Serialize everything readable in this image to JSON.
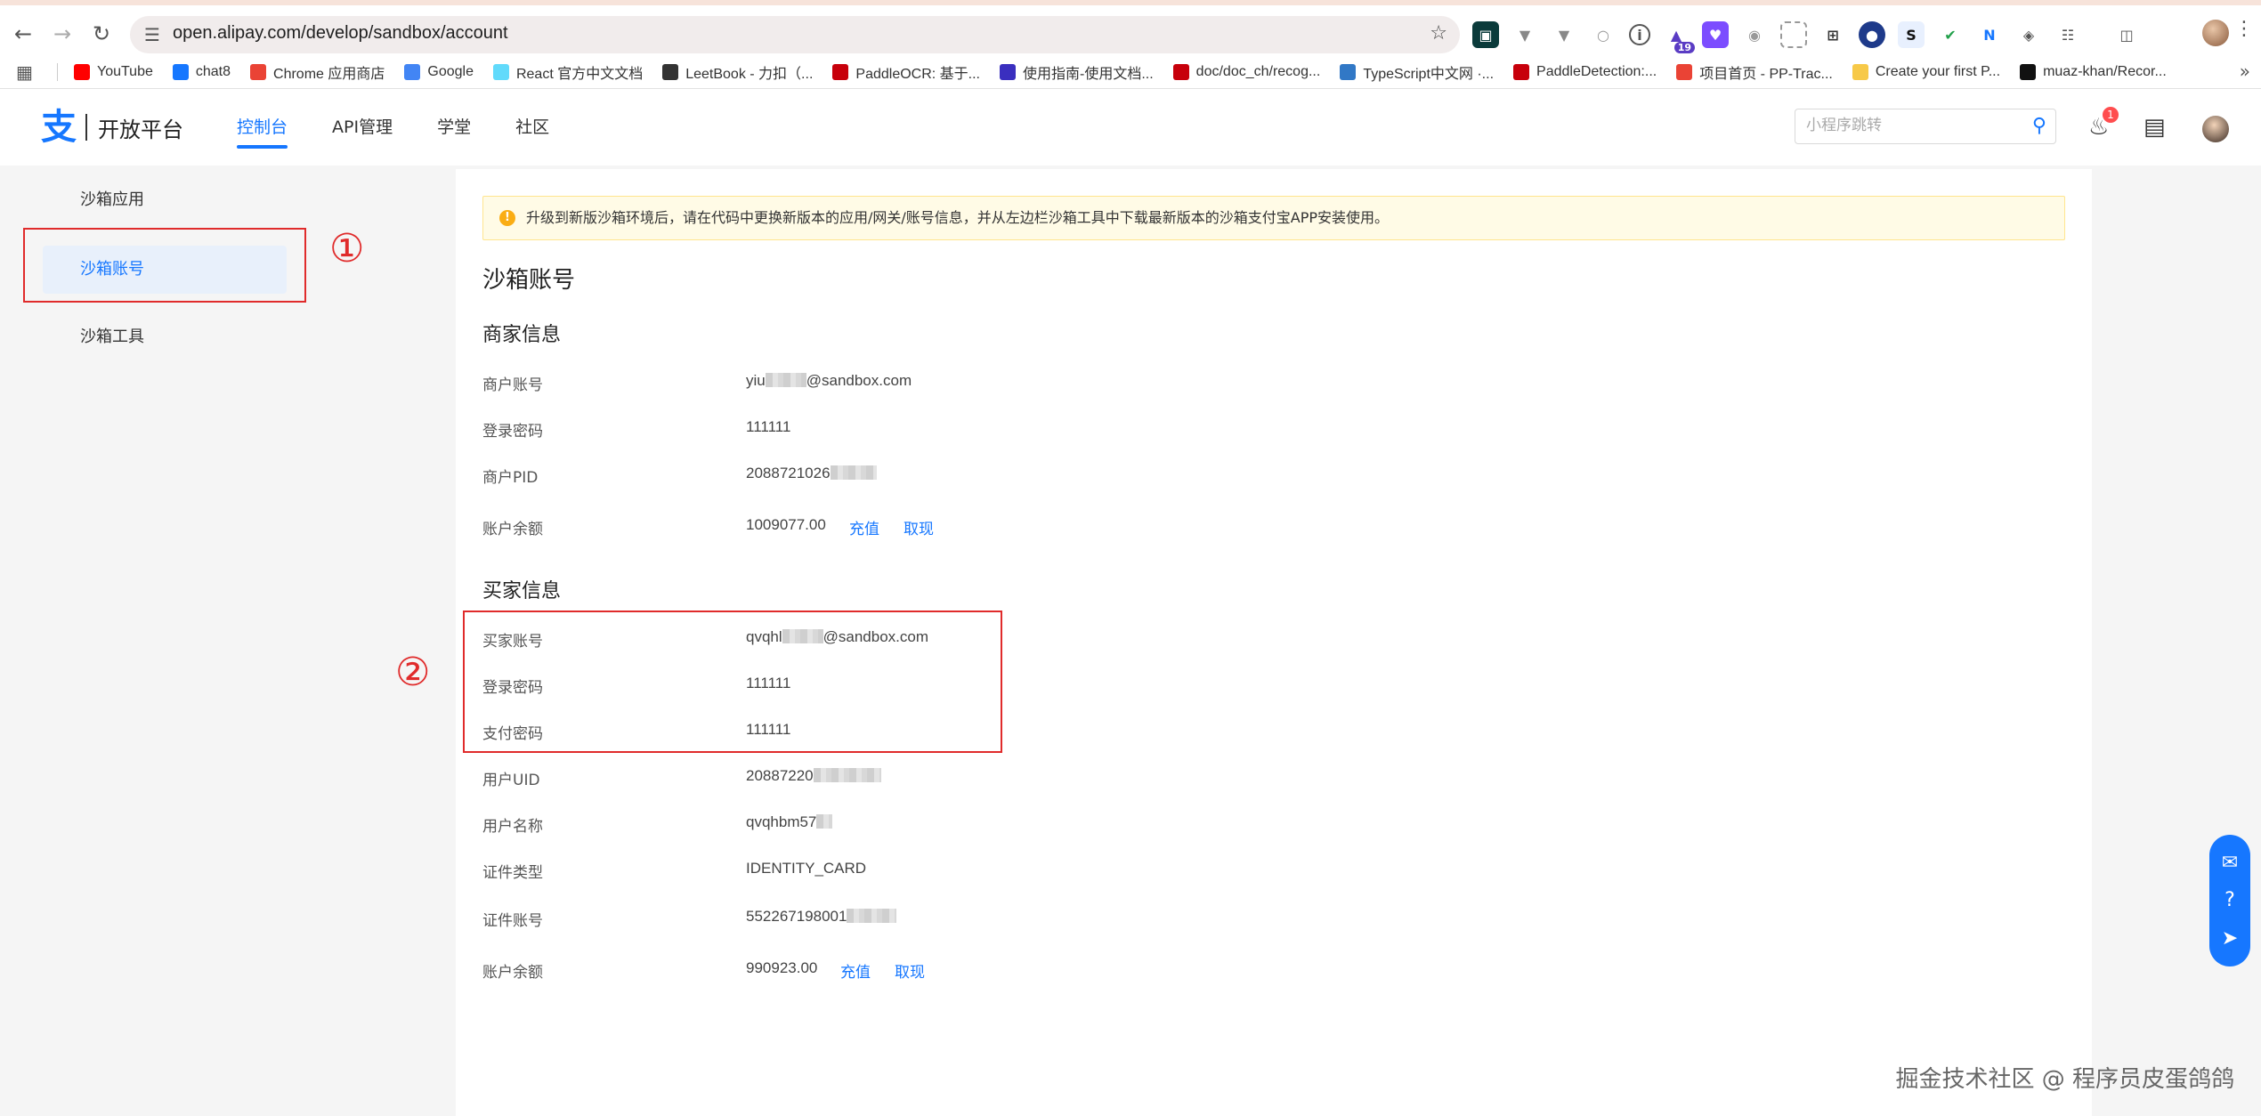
{
  "browser": {
    "url": "open.alipay.com/develop/sandbox/account",
    "bookmarks": [
      {
        "label": "YouTube",
        "color": "#ff0000"
      },
      {
        "label": "chat8",
        "color": "#1677ff"
      },
      {
        "label": "Chrome 应用商店",
        "color": "#ea4335"
      },
      {
        "label": "Google",
        "color": "#4285f4"
      },
      {
        "label": "React 官方中文文档",
        "color": "#61dafb"
      },
      {
        "label": "LeetBook - 力扣（...",
        "color": "#333333"
      },
      {
        "label": "PaddleOCR: 基于...",
        "color": "#c7000b"
      },
      {
        "label": "使用指南-使用文档...",
        "color": "#3a2fbf"
      },
      {
        "label": "doc/doc_ch/recog...",
        "color": "#c7000b"
      },
      {
        "label": "TypeScript中文网 ·...",
        "color": "#3178c6"
      },
      {
        "label": "PaddleDetection:...",
        "color": "#c7000b"
      },
      {
        "label": "项目首页 - PP-Trac...",
        "color": "#ea4335"
      },
      {
        "label": "Create your first P...",
        "color": "#f7c948"
      },
      {
        "label": "muaz-khan/Recor...",
        "color": "#111111"
      }
    ],
    "extension_badge": "19"
  },
  "header": {
    "logo_text": "开放平台",
    "tabs": [
      "控制台",
      "API管理",
      "学堂",
      "社区"
    ],
    "search_placeholder": "小程序跳转",
    "notification_count": "1"
  },
  "sidebar": {
    "items": [
      "沙箱应用",
      "沙箱账号",
      "沙箱工具"
    ]
  },
  "annotations": [
    "①",
    "②"
  ],
  "main": {
    "notice": "升级到新版沙箱环境后，请在代码中更换新版本的应用/网关/账号信息，并从左边栏沙箱工具中下载最新版本的沙箱支付宝APP安装使用。",
    "page_title": "沙箱账号",
    "merchant": {
      "title": "商家信息",
      "account_label": "商户账号",
      "account_prefix": "yiu",
      "account_suffix": "@sandbox.com",
      "password_label": "登录密码",
      "password": "111111",
      "pid_label": "商户PID",
      "pid_prefix": "2088721026",
      "balance_label": "账户余额",
      "balance": "1009077.00",
      "recharge": "充值",
      "withdraw": "取现"
    },
    "buyer": {
      "title": "买家信息",
      "account_label": "买家账号",
      "account_prefix": "qvqhl",
      "account_suffix": "@sandbox.com",
      "password_label": "登录密码",
      "password": "111111",
      "pay_password_label": "支付密码",
      "pay_password": "111111",
      "uid_label": "用户UID",
      "uid_prefix": "20887220",
      "name_label": "用户名称",
      "name_prefix": "qvqhbm57",
      "id_type_label": "证件类型",
      "id_type": "IDENTITY_CARD",
      "id_no_label": "证件账号",
      "id_no_prefix": "552267198001",
      "balance_label": "账户余额",
      "balance": "990923.00",
      "recharge": "充值",
      "withdraw": "取现"
    }
  },
  "watermark": "掘金技术社区 @ 程序员皮蛋鸽鸽"
}
